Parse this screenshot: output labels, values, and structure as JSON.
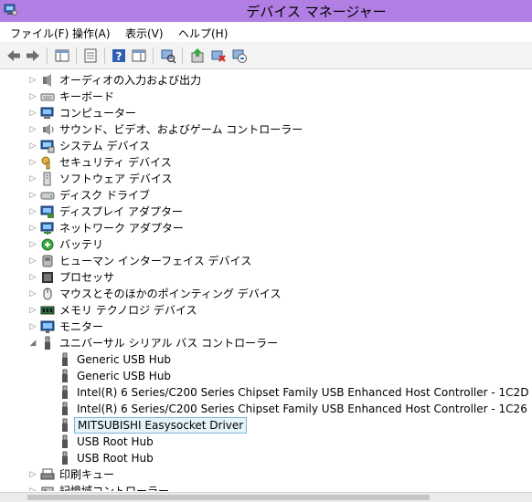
{
  "window": {
    "title": "デバイス マネージャー",
    "accent": "#b17fe3"
  },
  "menu": [
    "ファイル(F)",
    "操作(A)",
    "表示(V)",
    "ヘルプ(H)"
  ],
  "toolbar": {
    "icons": [
      "back-arrow-icon",
      "forward-arrow-icon",
      "show-hide-tree-icon",
      "properties-icon",
      "help-icon",
      "action-pane-icon",
      "scan-hardware-icon",
      "update-driver-icon",
      "uninstall-icon",
      "disable-device-icon"
    ]
  },
  "tree": {
    "categories": [
      {
        "label": "オーディオの入力および出力",
        "icon": "audio-icon"
      },
      {
        "label": "キーボード",
        "icon": "keyboard-icon"
      },
      {
        "label": "コンピューター",
        "icon": "computer-icon"
      },
      {
        "label": "サウンド、ビデオ、およびゲーム コントローラー",
        "icon": "sound-icon"
      },
      {
        "label": "システム デバイス",
        "icon": "system-device-icon"
      },
      {
        "label": "セキュリティ デバイス",
        "icon": "security-key-icon"
      },
      {
        "label": "ソフトウェア デバイス",
        "icon": "software-device-icon"
      },
      {
        "label": "ディスク ドライブ",
        "icon": "disk-drive-icon"
      },
      {
        "label": "ディスプレイ アダプター",
        "icon": "display-adapter-icon"
      },
      {
        "label": "ネットワーク アダプター",
        "icon": "network-adapter-icon"
      },
      {
        "label": "バッテリ",
        "icon": "battery-icon"
      },
      {
        "label": "ヒューマン インターフェイス デバイス",
        "icon": "hid-icon"
      },
      {
        "label": "プロセッサ",
        "icon": "processor-icon"
      },
      {
        "label": "マウスとそのほかのポインティング デバイス",
        "icon": "mouse-icon"
      },
      {
        "label": "メモリ テクノロジ デバイス",
        "icon": "memory-icon"
      },
      {
        "label": "モニター",
        "icon": "monitor-icon"
      }
    ],
    "usb": {
      "label": "ユニバーサル シリアル バス コントローラー",
      "icon": "usb-icon",
      "children": [
        {
          "label": "Generic USB Hub"
        },
        {
          "label": "Generic USB Hub"
        },
        {
          "label": "Intel(R) 6 Series/C200 Series Chipset Family USB Enhanced Host Controller - 1C2D"
        },
        {
          "label": "Intel(R) 6 Series/C200 Series Chipset Family USB Enhanced Host Controller - 1C26"
        },
        {
          "label": "MITSUBISHI Easysocket Driver",
          "selected": true
        },
        {
          "label": "USB Root Hub"
        },
        {
          "label": "USB Root Hub"
        }
      ]
    },
    "after": [
      {
        "label": "印刷キュー",
        "icon": "print-queue-icon"
      },
      {
        "label": "記憶域コントローラー",
        "icon": "storage-controller-icon"
      }
    ]
  }
}
